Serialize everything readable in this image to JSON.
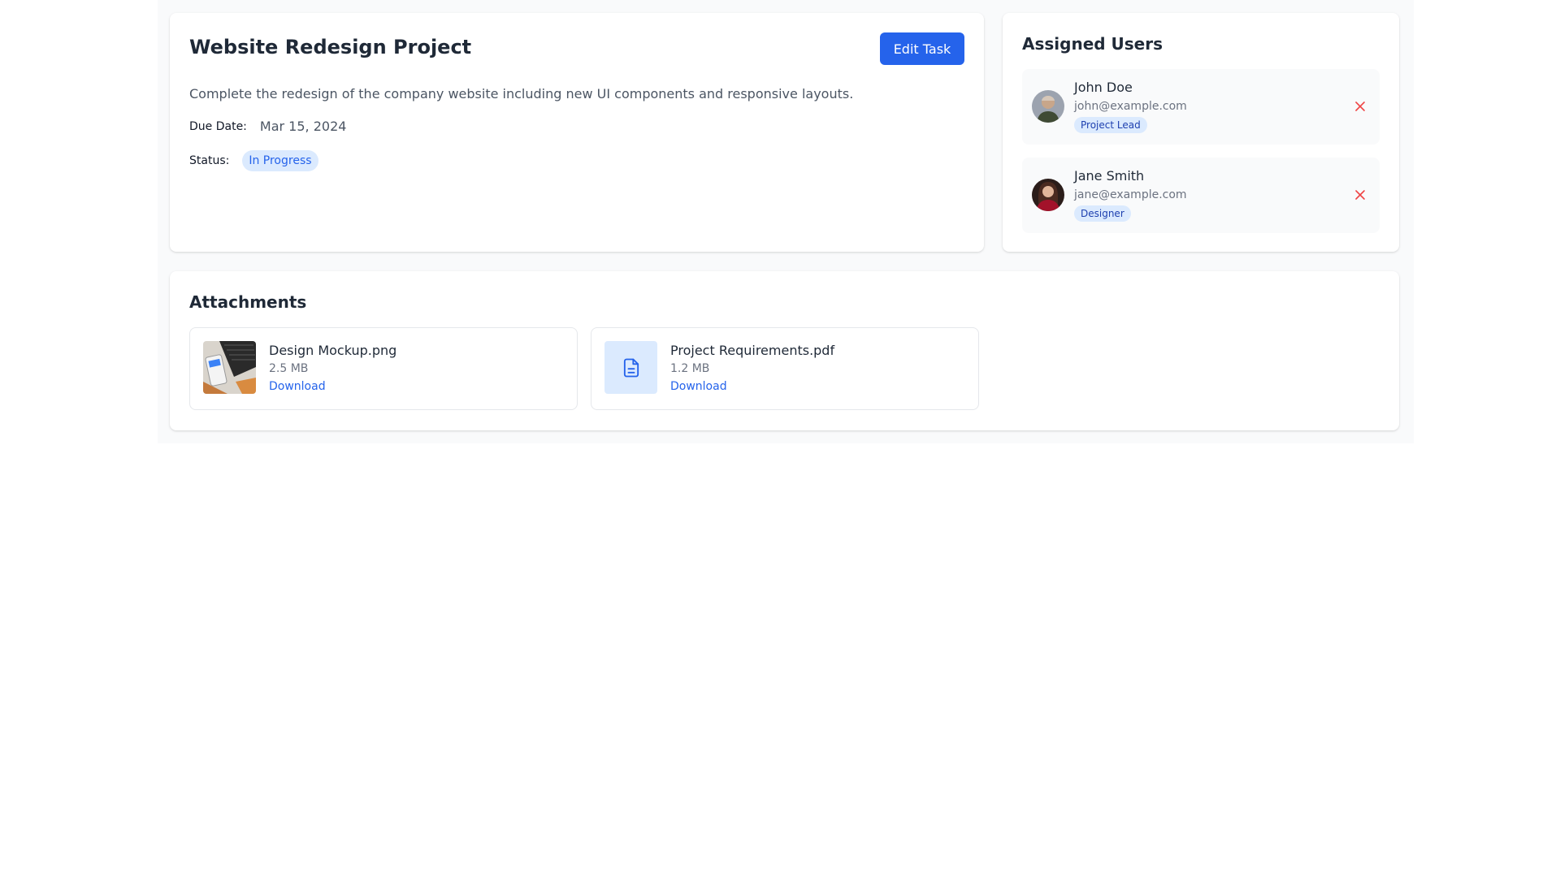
{
  "task": {
    "title": "Website Redesign Project",
    "edit_label": "Edit Task",
    "description": "Complete the redesign of the company website including new UI components and responsive layouts.",
    "due_label": "Due Date:",
    "due_value": "Mar 15, 2024",
    "status_label": "Status:",
    "status_value": "In Progress"
  },
  "users": {
    "title": "Assigned Users",
    "items": [
      {
        "name": "John Doe",
        "email": "john@example.com",
        "role": "Project Lead",
        "remove_icon": "close-icon"
      },
      {
        "name": "Jane Smith",
        "email": "jane@example.com",
        "role": "Designer",
        "remove_icon": "close-icon"
      }
    ]
  },
  "attachments": {
    "title": "Attachments",
    "items": [
      {
        "name": "Design Mockup.png",
        "size": "2.5 MB",
        "download_label": "Download",
        "preview": "image-thumbnail"
      },
      {
        "name": "Project Requirements.pdf",
        "size": "1.2 MB",
        "download_label": "Download",
        "preview": "document-icon"
      }
    ]
  },
  "colors": {
    "primary": "#2563eb",
    "badge_bg": "#dbeafe",
    "danger": "#ef4444",
    "background": "#f9fafb"
  }
}
